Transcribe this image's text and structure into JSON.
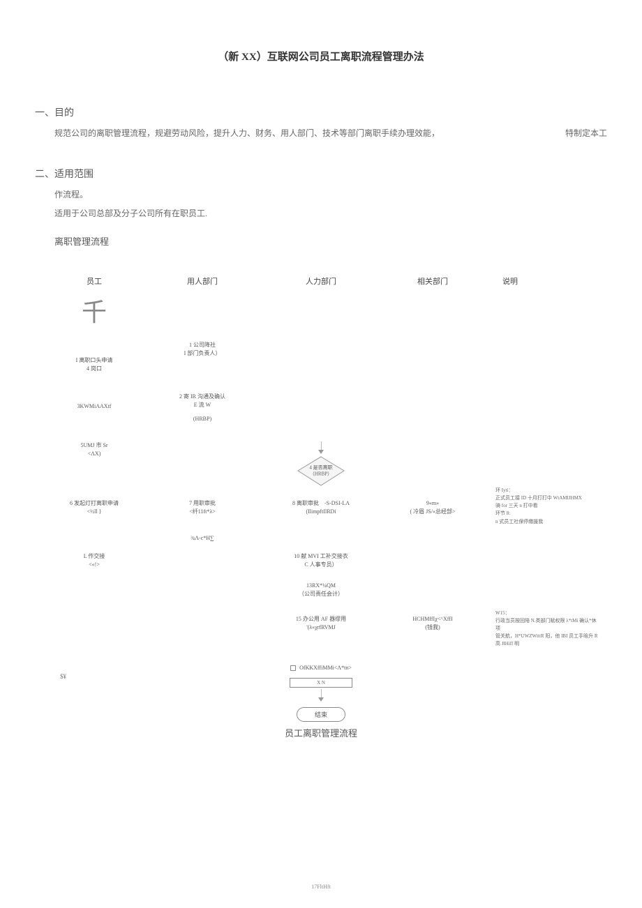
{
  "title": "（新 XX）互联网公司员工离职流程管理办法",
  "section1": {
    "head": "一、目的",
    "body_left": "规范公司的离职管理流程，规避劳动风险，提升人力、财务、用人部门、技术等部门离职手续办理效能，",
    "body_right": "特制定本工"
  },
  "section2": {
    "head": "二、适用范围",
    "line1": "作流程。",
    "line2": "适用于公司总部及分子公司所有在职员工."
  },
  "flow_heading": "离职管理流程",
  "columns": {
    "c1": "员工",
    "c2": "用人部门",
    "c3": "人力部门",
    "c4": "相关部门",
    "c5": "说明"
  },
  "glyph": "千",
  "rows": {
    "r1": {
      "c1a": "I 离职口头申请",
      "c1b": "4 岗口",
      "c2a": "1 公司降社",
      "c2b": "I 部门负责人）"
    },
    "r2": {
      "c1": "3KWMiAAXtf",
      "c2a": "2 寄 IR 沟通及确认",
      "c2b": "E 流 W",
      "c2c": "(HRBP)"
    },
    "r3": {
      "c1a": "5UMJ 市 Sr",
      "c1b": "<ΛX)"
    },
    "decision": {
      "label_a": "4 是否离职",
      "label_b": "（HRBP）"
    },
    "r4": {
      "c1a": "6 发起灯打离职申请",
      "c1b": "<½ll }",
      "c2a": "7 用职审批",
      "c2b": "<纤11ft*λ>",
      "c3a": "8 离职审批",
      "c3b": "(IlimpftIlRDi",
      "c3c": "-S-DSI-LA",
      "c4a": "9«m»",
      "c4b": "( 冷眉 JS/«总经部>",
      "c5a": "环 Iytí：",
      "c5b": "正式员工接 ID 十月打打中 WtAMIJHMX",
      "c5c": "骑 for 三天 n 打中看",
      "c5d": "环节 8:",
      "c5e": "n 式员工社保停缴援我"
    },
    "r4b": {
      "c2": "¾Λ-c*H∑"
    },
    "r5": {
      "c1a": "L 作交接",
      "c1b": "<«!>",
      "c3a": "10 献 MVI 工补交接衣",
      "c3b": "C 人事专员）"
    },
    "r6": {
      "c3a": "13RX*¼QM",
      "c3b": "（公司责任会计）"
    },
    "r7": {
      "c3a": "15 办公用 AF 器缪用",
      "c3b": "'(λ«χrfRVMJ",
      "c4a": "HCHMffIχ<^XffI",
      "c4b": "(钱我)",
      "c5a": "W15：",
      "c5b": "行政当员按回陪 N.类部门赋权限 λ*tMi 确认*休项",
      "c5c": "管关航，H*UWZWtttR 阳，他 IBI 员工手晗升 R",
      "c5d": "高 JIHiff 明"
    },
    "r8": {
      "c3": "OfKKXffiMMi<Λ*tn>"
    },
    "endbox": "X        N",
    "endoval": "结束"
  },
  "flow_title": "员工离职管理流程",
  "side_mark": "$¥",
  "footer": "17FltHft"
}
